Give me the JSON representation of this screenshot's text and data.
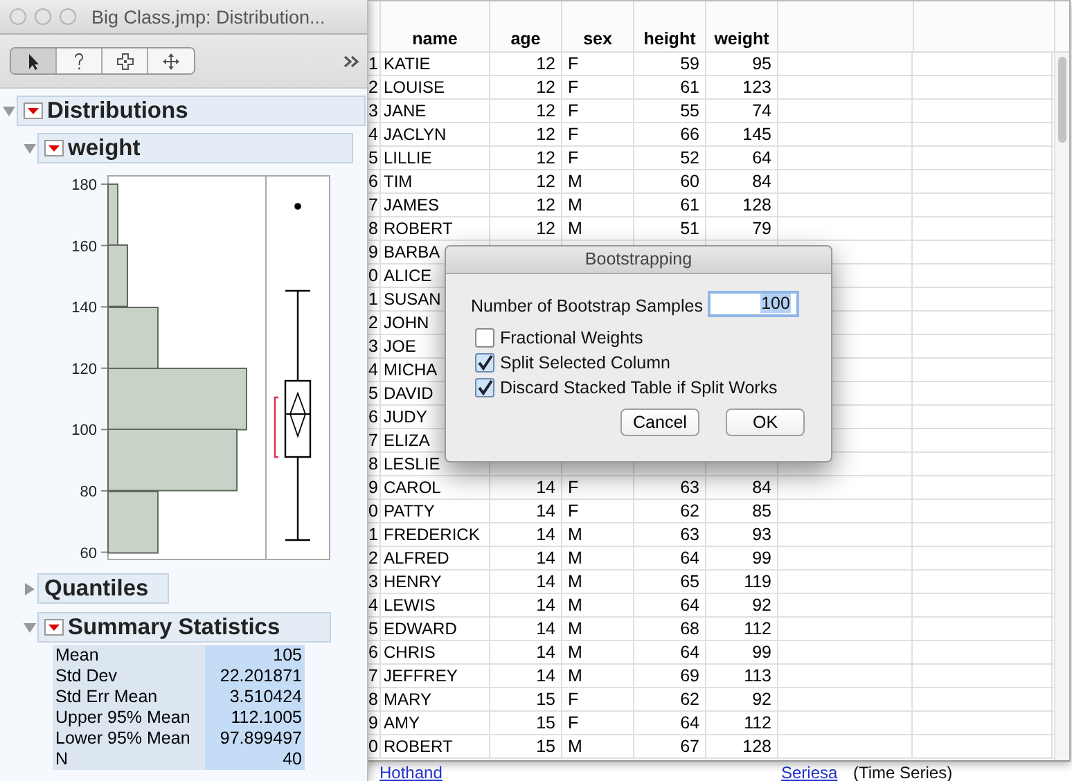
{
  "analysis_window": {
    "title": "Big Class.jmp: Distribution...",
    "toolbar": [
      {
        "kind": "arrow",
        "selected": true
      },
      {
        "kind": "help",
        "selected": false
      },
      {
        "kind": "crosshair",
        "selected": false
      },
      {
        "kind": "move",
        "selected": false
      }
    ],
    "report": {
      "title": "Distributions",
      "expanded": true,
      "variable": {
        "title": "weight",
        "expanded": true,
        "axis_ticks": [
          "180",
          "160",
          "140",
          "120",
          "100",
          "80",
          "60"
        ],
        "quantiles": {
          "title": "Quantiles",
          "expanded": false
        },
        "summary": {
          "title": "Summary Statistics",
          "expanded": true,
          "rows": [
            {
              "label": "Mean",
              "value": "105"
            },
            {
              "label": "Std Dev",
              "value": "22.201871"
            },
            {
              "label": "Std Err Mean",
              "value": "3.510424"
            },
            {
              "label": "Upper 95% Mean",
              "value": "112.1005"
            },
            {
              "label": "Lower 95% Mean",
              "value": "97.899497"
            },
            {
              "label": "N",
              "value": "40"
            }
          ]
        }
      }
    }
  },
  "data_table": {
    "columns": [
      "name",
      "age",
      "sex",
      "height",
      "weight"
    ],
    "rows": [
      {
        "row": "1",
        "cells": [
          "KATIE",
          "12",
          "F",
          "59",
          "95"
        ]
      },
      {
        "row": "2",
        "cells": [
          "LOUISE",
          "12",
          "F",
          "61",
          "123"
        ]
      },
      {
        "row": "3",
        "cells": [
          "JANE",
          "12",
          "F",
          "55",
          "74"
        ]
      },
      {
        "row": "4",
        "cells": [
          "JACLYN",
          "12",
          "F",
          "66",
          "145"
        ]
      },
      {
        "row": "5",
        "cells": [
          "LILLIE",
          "12",
          "F",
          "52",
          "64"
        ]
      },
      {
        "row": "6",
        "cells": [
          "TIM",
          "12",
          "M",
          "60",
          "84"
        ]
      },
      {
        "row": "7",
        "cells": [
          "JAMES",
          "12",
          "M",
          "61",
          "128"
        ]
      },
      {
        "row": "8",
        "cells": [
          "ROBERT",
          "12",
          "M",
          "51",
          "79"
        ]
      },
      {
        "row": "9",
        "cells": [
          "BARBA"
        ]
      },
      {
        "row": "0",
        "cells": [
          "ALICE"
        ]
      },
      {
        "row": "1",
        "cells": [
          "SUSAN"
        ]
      },
      {
        "row": "2",
        "cells": [
          "JOHN"
        ]
      },
      {
        "row": "3",
        "cells": [
          "JOE"
        ]
      },
      {
        "row": "4",
        "cells": [
          "MICHA"
        ]
      },
      {
        "row": "5",
        "cells": [
          "DAVID"
        ]
      },
      {
        "row": "6",
        "cells": [
          "JUDY"
        ]
      },
      {
        "row": "7",
        "cells": [
          "ELIZA"
        ]
      },
      {
        "row": "8",
        "cells": [
          "LESLIE"
        ]
      },
      {
        "row": "9",
        "cells": [
          "CAROL",
          "14",
          "F",
          "63",
          "84"
        ]
      },
      {
        "row": "0",
        "cells": [
          "PATTY",
          "14",
          "F",
          "62",
          "85"
        ]
      },
      {
        "row": "1",
        "cells": [
          "FREDERICK",
          "14",
          "M",
          "63",
          "93"
        ]
      },
      {
        "row": "2",
        "cells": [
          "ALFRED",
          "14",
          "M",
          "64",
          "99"
        ]
      },
      {
        "row": "3",
        "cells": [
          "HENRY",
          "14",
          "M",
          "65",
          "119"
        ]
      },
      {
        "row": "4",
        "cells": [
          "LEWIS",
          "14",
          "M",
          "64",
          "92"
        ]
      },
      {
        "row": "5",
        "cells": [
          "EDWARD",
          "14",
          "M",
          "68",
          "112"
        ]
      },
      {
        "row": "6",
        "cells": [
          "CHRIS",
          "14",
          "M",
          "64",
          "99"
        ]
      },
      {
        "row": "7",
        "cells": [
          "JEFFREY",
          "14",
          "M",
          "69",
          "113"
        ]
      },
      {
        "row": "8",
        "cells": [
          "MARY",
          "15",
          "F",
          "62",
          "92"
        ]
      },
      {
        "row": "9",
        "cells": [
          "AMY",
          "15",
          "F",
          "64",
          "112"
        ]
      },
      {
        "row": "0",
        "cells": [
          "ROBERT",
          "15",
          "M",
          "67",
          "128"
        ]
      }
    ]
  },
  "background_links": [
    {
      "kind": "link",
      "text": "Hothand"
    },
    {
      "kind": "link",
      "text": "Seriesa"
    },
    {
      "kind": "note",
      "text": "(Time Series)"
    }
  ],
  "dialog": {
    "title": "Bootstrapping",
    "field": {
      "label": "Number of Bootstrap Samples",
      "value": "100",
      "value_selected": true
    },
    "options": [
      {
        "label": "Fractional Weights",
        "checked": false
      },
      {
        "label": "Split Selected Column",
        "checked": true
      },
      {
        "label": "Discard Stacked Table if Split Works",
        "checked": true
      }
    ],
    "buttons": [
      "Cancel",
      "OK"
    ]
  }
}
